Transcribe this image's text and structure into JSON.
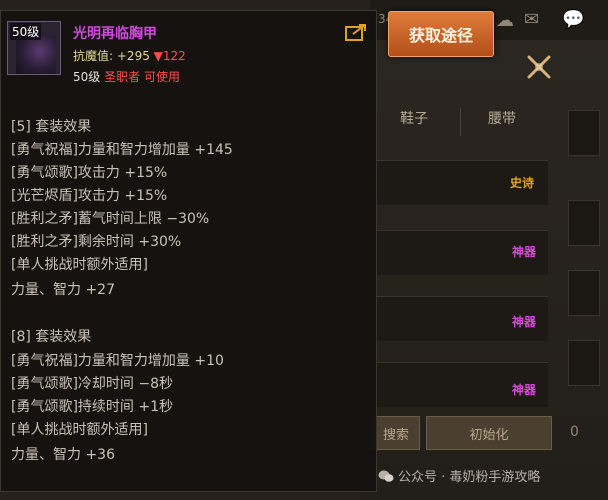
{
  "item": {
    "level_badge": "50级",
    "name": "光明再临胸甲",
    "resist_label": "抗魔值:",
    "resist_value": "+295",
    "resist_diff": "▼122",
    "req_level": "50级",
    "req_class": "圣职者",
    "req_usable": "可使用"
  },
  "get_button_label": "获取途径",
  "set5": {
    "header": "[5] 套装效果",
    "lines": [
      "[勇气祝福]力量和智力增加量 +145",
      "[勇气颂歌]攻击力 +15%",
      "[光芒烬盾]攻击力 +15%",
      "[胜利之矛]蓄气时间上限 −30%",
      "[胜利之矛]剩余时间 +30%",
      "[单人挑战时额外适用]",
      "力量、智力 +27"
    ]
  },
  "set8": {
    "header": "[8] 套装效果",
    "lines": [
      "[勇气祝福]力量和智力增加量 +10",
      "[勇气颂歌]冷却时间 −8秒",
      "[勇气颂歌]持续时间 +1秒",
      "[单人挑战时额外适用]",
      "力量、智力 +36"
    ]
  },
  "background": {
    "tabs": [
      "鞋子",
      "腰带"
    ],
    "tags": [
      "史诗",
      "神器",
      "神器",
      "神器"
    ],
    "tag_colors": [
      "#e0a21a",
      "#d54ad8",
      "#d54ad8",
      "#d54ad8"
    ],
    "buttons": [
      "搜索",
      "初始化"
    ],
    "top_number": "34",
    "side_number": "0"
  },
  "watermark": "公众号 · 毒奶粉手游攻略"
}
